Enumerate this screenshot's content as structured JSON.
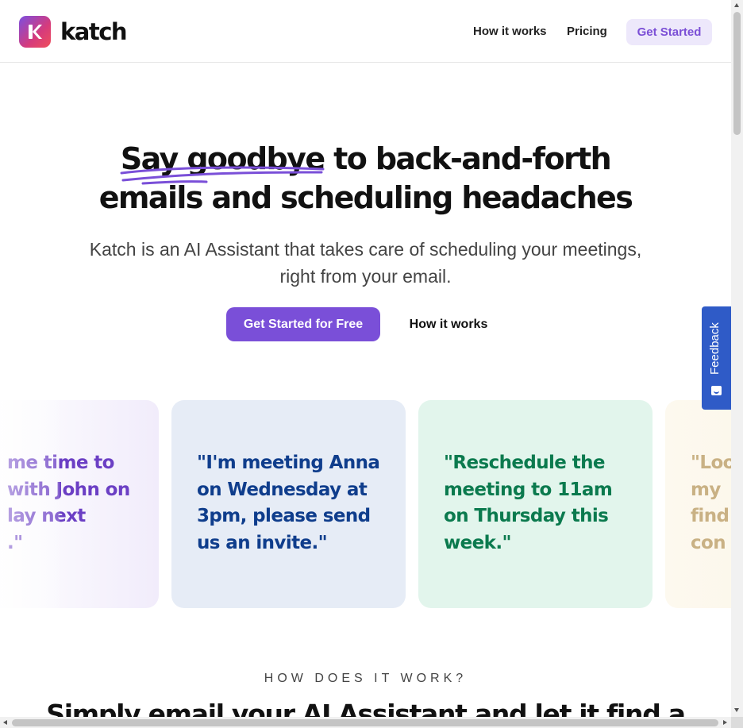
{
  "header": {
    "logo_text": "katch",
    "logo_glyph": "K",
    "nav": {
      "how_it_works": "How it works",
      "pricing": "Pricing",
      "get_started": "Get Started"
    }
  },
  "hero": {
    "title_emphasis": "Say goodbye",
    "title_rest_line1": " to back-and-forth",
    "title_line2": "emails and scheduling headaches",
    "subtitle": "Katch is an AI Assistant that takes care of scheduling your meetings, right from your email.",
    "primary_button": "Get Started for Free",
    "secondary_button": "How it works"
  },
  "cards": [
    {
      "quote": "me time to\nwith John on\nlay next\n.\""
    },
    {
      "quote": "\"I'm meeting Anna on Wednesday at 3pm, please send us an invite.\""
    },
    {
      "quote": "\"Reschedule the meeting to 11am on Thursday this week.\""
    },
    {
      "quote": "\"Loo\nmy\nfind\ncon"
    }
  ],
  "feedback": {
    "label": "Feedback",
    "icon": "smile-icon"
  },
  "how_section": {
    "eyebrow": "HOW DOES IT WORK?",
    "title": "Simply email your AI Assistant and let it find a"
  },
  "colors": {
    "brand_purple": "#7a4fd8",
    "feedback_blue": "#2f5bc7"
  }
}
